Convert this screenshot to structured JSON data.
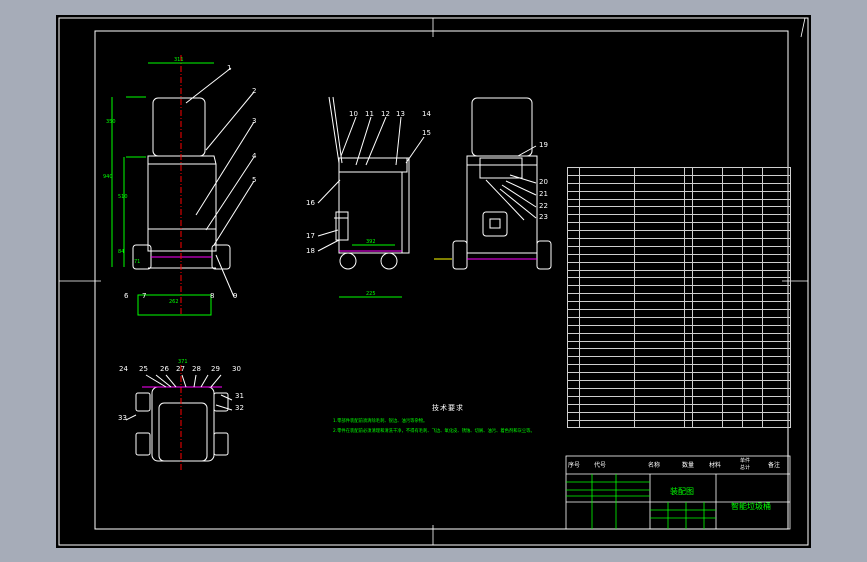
{
  "drawing": {
    "tech_requirements": {
      "heading": "技术要求",
      "lines": [
        "1.零部件装配前须清除毛刺、锐边、油污等杂物。",
        "2.零件在装配前必须清理和清洗干净，不得有毛刺、飞边、氧化皮、锈蚀、切屑、油污、着色剂和灰尘等。"
      ]
    },
    "title_block": {
      "assembly_title": "装配图",
      "drawing_name": "智能垃圾桶",
      "bom_header": [
        "序号",
        "代号",
        "名称",
        "数量",
        "材料",
        "单件",
        "总计",
        "备注"
      ]
    },
    "balloons": {
      "front": [
        "1",
        "2",
        "3",
        "4",
        "5",
        "6",
        "7",
        "8",
        "9"
      ],
      "side": [
        "10",
        "11",
        "12",
        "13",
        "14",
        "15",
        "16",
        "17",
        "18"
      ],
      "rear": [
        "19",
        "20",
        "21",
        "22",
        "23"
      ],
      "top": [
        "24",
        "25",
        "26",
        "27",
        "28",
        "29",
        "30",
        "31",
        "32",
        "33"
      ]
    },
    "dims": [
      "311",
      "350",
      "510",
      "940",
      "262",
      "392",
      "225",
      "371",
      "84",
      "71"
    ]
  },
  "colors": {
    "sheet": "#000000",
    "outline": "#ffffff",
    "centerline": "#ff0000",
    "dimension": "#00ff00",
    "hidden": "#ffff00",
    "magenta": "#ff00ff",
    "frame": "#a6acb8"
  }
}
